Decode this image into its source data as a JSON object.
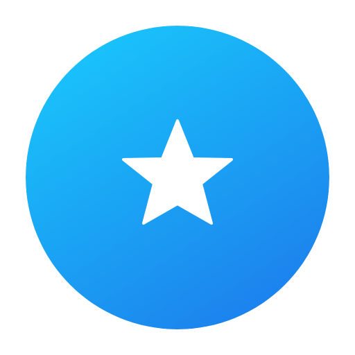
{
  "icon": {
    "name": "star-icon",
    "gradient_start": "#19C6FB",
    "gradient_end": "#1C7CEC",
    "glyph_color": "#FFFFFF"
  }
}
